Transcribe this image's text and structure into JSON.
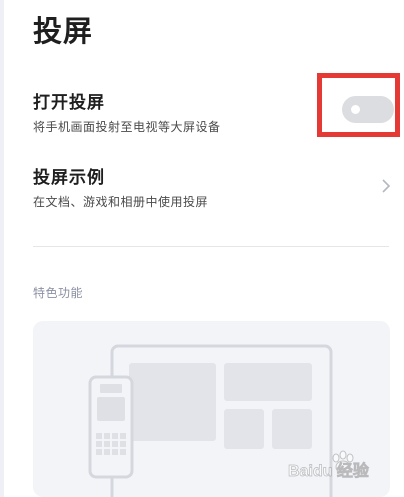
{
  "page": {
    "title": "投屏"
  },
  "cast_row": {
    "title": "打开投屏",
    "subtitle": "将手机画面投射至电视等大屏设备",
    "toggle_on": false
  },
  "example_row": {
    "title": "投屏示例",
    "subtitle": "在文档、游戏和相册中使用投屏"
  },
  "features": {
    "label": "特色功能"
  },
  "watermark": {
    "text": "Baidu 经验"
  },
  "colors": {
    "highlight_border": "#e53935",
    "toggle_off": "#dcdde1",
    "card_bg": "#f3f4f8"
  },
  "icons": [
    "chevron-right-icon",
    "tv-illustration",
    "phone-illustration",
    "baidu-paw-icon"
  ]
}
